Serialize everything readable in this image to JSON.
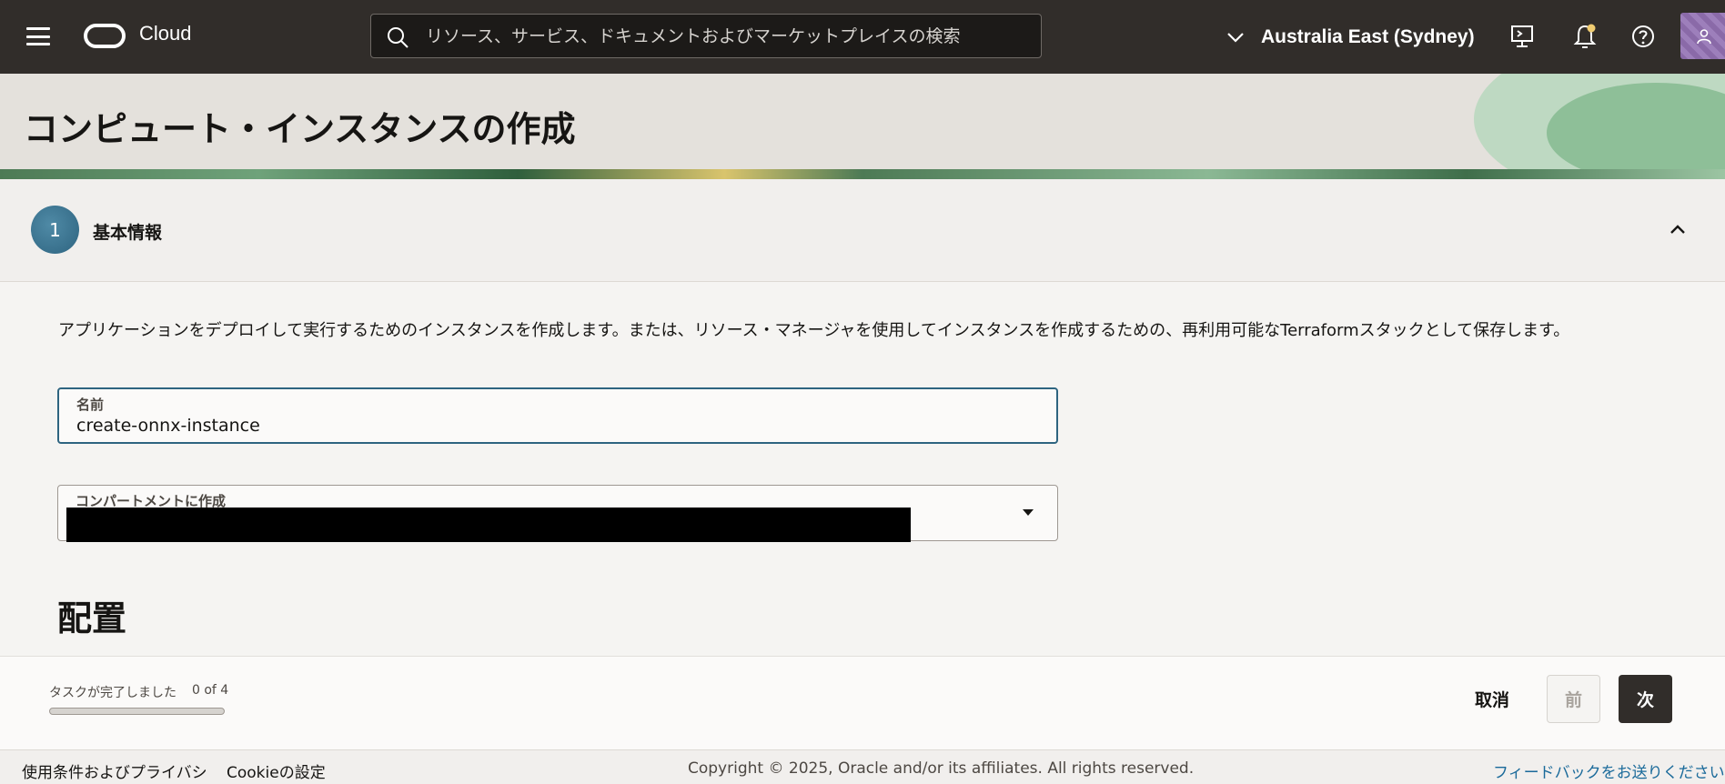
{
  "nav": {
    "logo_text": "Cloud",
    "search_placeholder": "リソース、サービス、ドキュメントおよびマーケットプレイスの検索",
    "region": "Australia East (Sydney)",
    "icons": [
      "menu-icon",
      "search-icon",
      "chevron-down-icon",
      "cloud-shell-icon",
      "bell-icon",
      "help-icon",
      "user-icon"
    ]
  },
  "page": {
    "title": "コンピュート・インスタンスの作成"
  },
  "step": {
    "number": "1",
    "label": "基本情報"
  },
  "form": {
    "description": "アプリケーションをデプロイして実行するためのインスタンスを作成します。または、リソース・マネージャを使用してインスタンスを作成するための、再利用可能なTerraformスタックとして保存します。",
    "name_label": "名前",
    "name_value": "create-onnx-instance",
    "compartment_label": "コンパートメントに作成",
    "section_heading": "配置"
  },
  "progress": {
    "label": "タスクが完了しました",
    "count": "0 of 4",
    "fraction": 0
  },
  "actions": {
    "cancel": "取消",
    "previous": "前",
    "next": "次"
  },
  "footer": {
    "terms": "使用条件およびプライバシ",
    "cookie": "Cookieの設定",
    "copyright": "Copyright © 2025, Oracle and/or its affiliates. All rights reserved.",
    "feedback": "フィードバックをお送りください"
  },
  "colors": {
    "topbar": "#312d2a",
    "accent": "#2e6480",
    "primary_button": "#312d2a"
  }
}
